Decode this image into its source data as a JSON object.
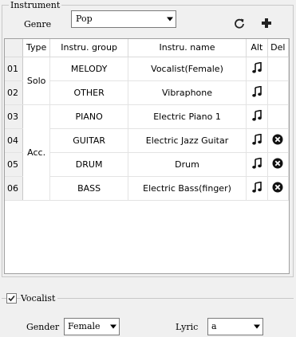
{
  "instrument": {
    "title": "Instrument",
    "genre_label": "Genre",
    "genre_value": "Pop",
    "icons": {
      "refresh": "refresh-icon",
      "add": "plus-icon"
    }
  },
  "table": {
    "headers": [
      "Type",
      "Instru. group",
      "Instru. name",
      "Alt",
      "Del"
    ],
    "types": [
      {
        "label": "Solo",
        "rows": 2
      },
      {
        "label": "Acc.",
        "rows": 4
      }
    ],
    "rows": [
      {
        "num": "01",
        "group": "MELODY",
        "name": "Vocalist(Female)",
        "alt": true,
        "del": false
      },
      {
        "num": "02",
        "group": "OTHER",
        "name": "Vibraphone",
        "alt": true,
        "del": false
      },
      {
        "num": "03",
        "group": "PIANO",
        "name": "Electric Piano 1",
        "alt": true,
        "del": false
      },
      {
        "num": "04",
        "group": "GUITAR",
        "name": "Electric Jazz Guitar",
        "alt": true,
        "del": true
      },
      {
        "num": "05",
        "group": "DRUM",
        "name": "Drum",
        "alt": true,
        "del": true
      },
      {
        "num": "06",
        "group": "BASS",
        "name": "Electric Bass(finger)",
        "alt": true,
        "del": true
      }
    ]
  },
  "vocalist": {
    "label": "Vocalist",
    "checked": true,
    "gender_label": "Gender",
    "gender_value": "Female",
    "lyric_label": "Lyric",
    "lyric_value": "a"
  }
}
